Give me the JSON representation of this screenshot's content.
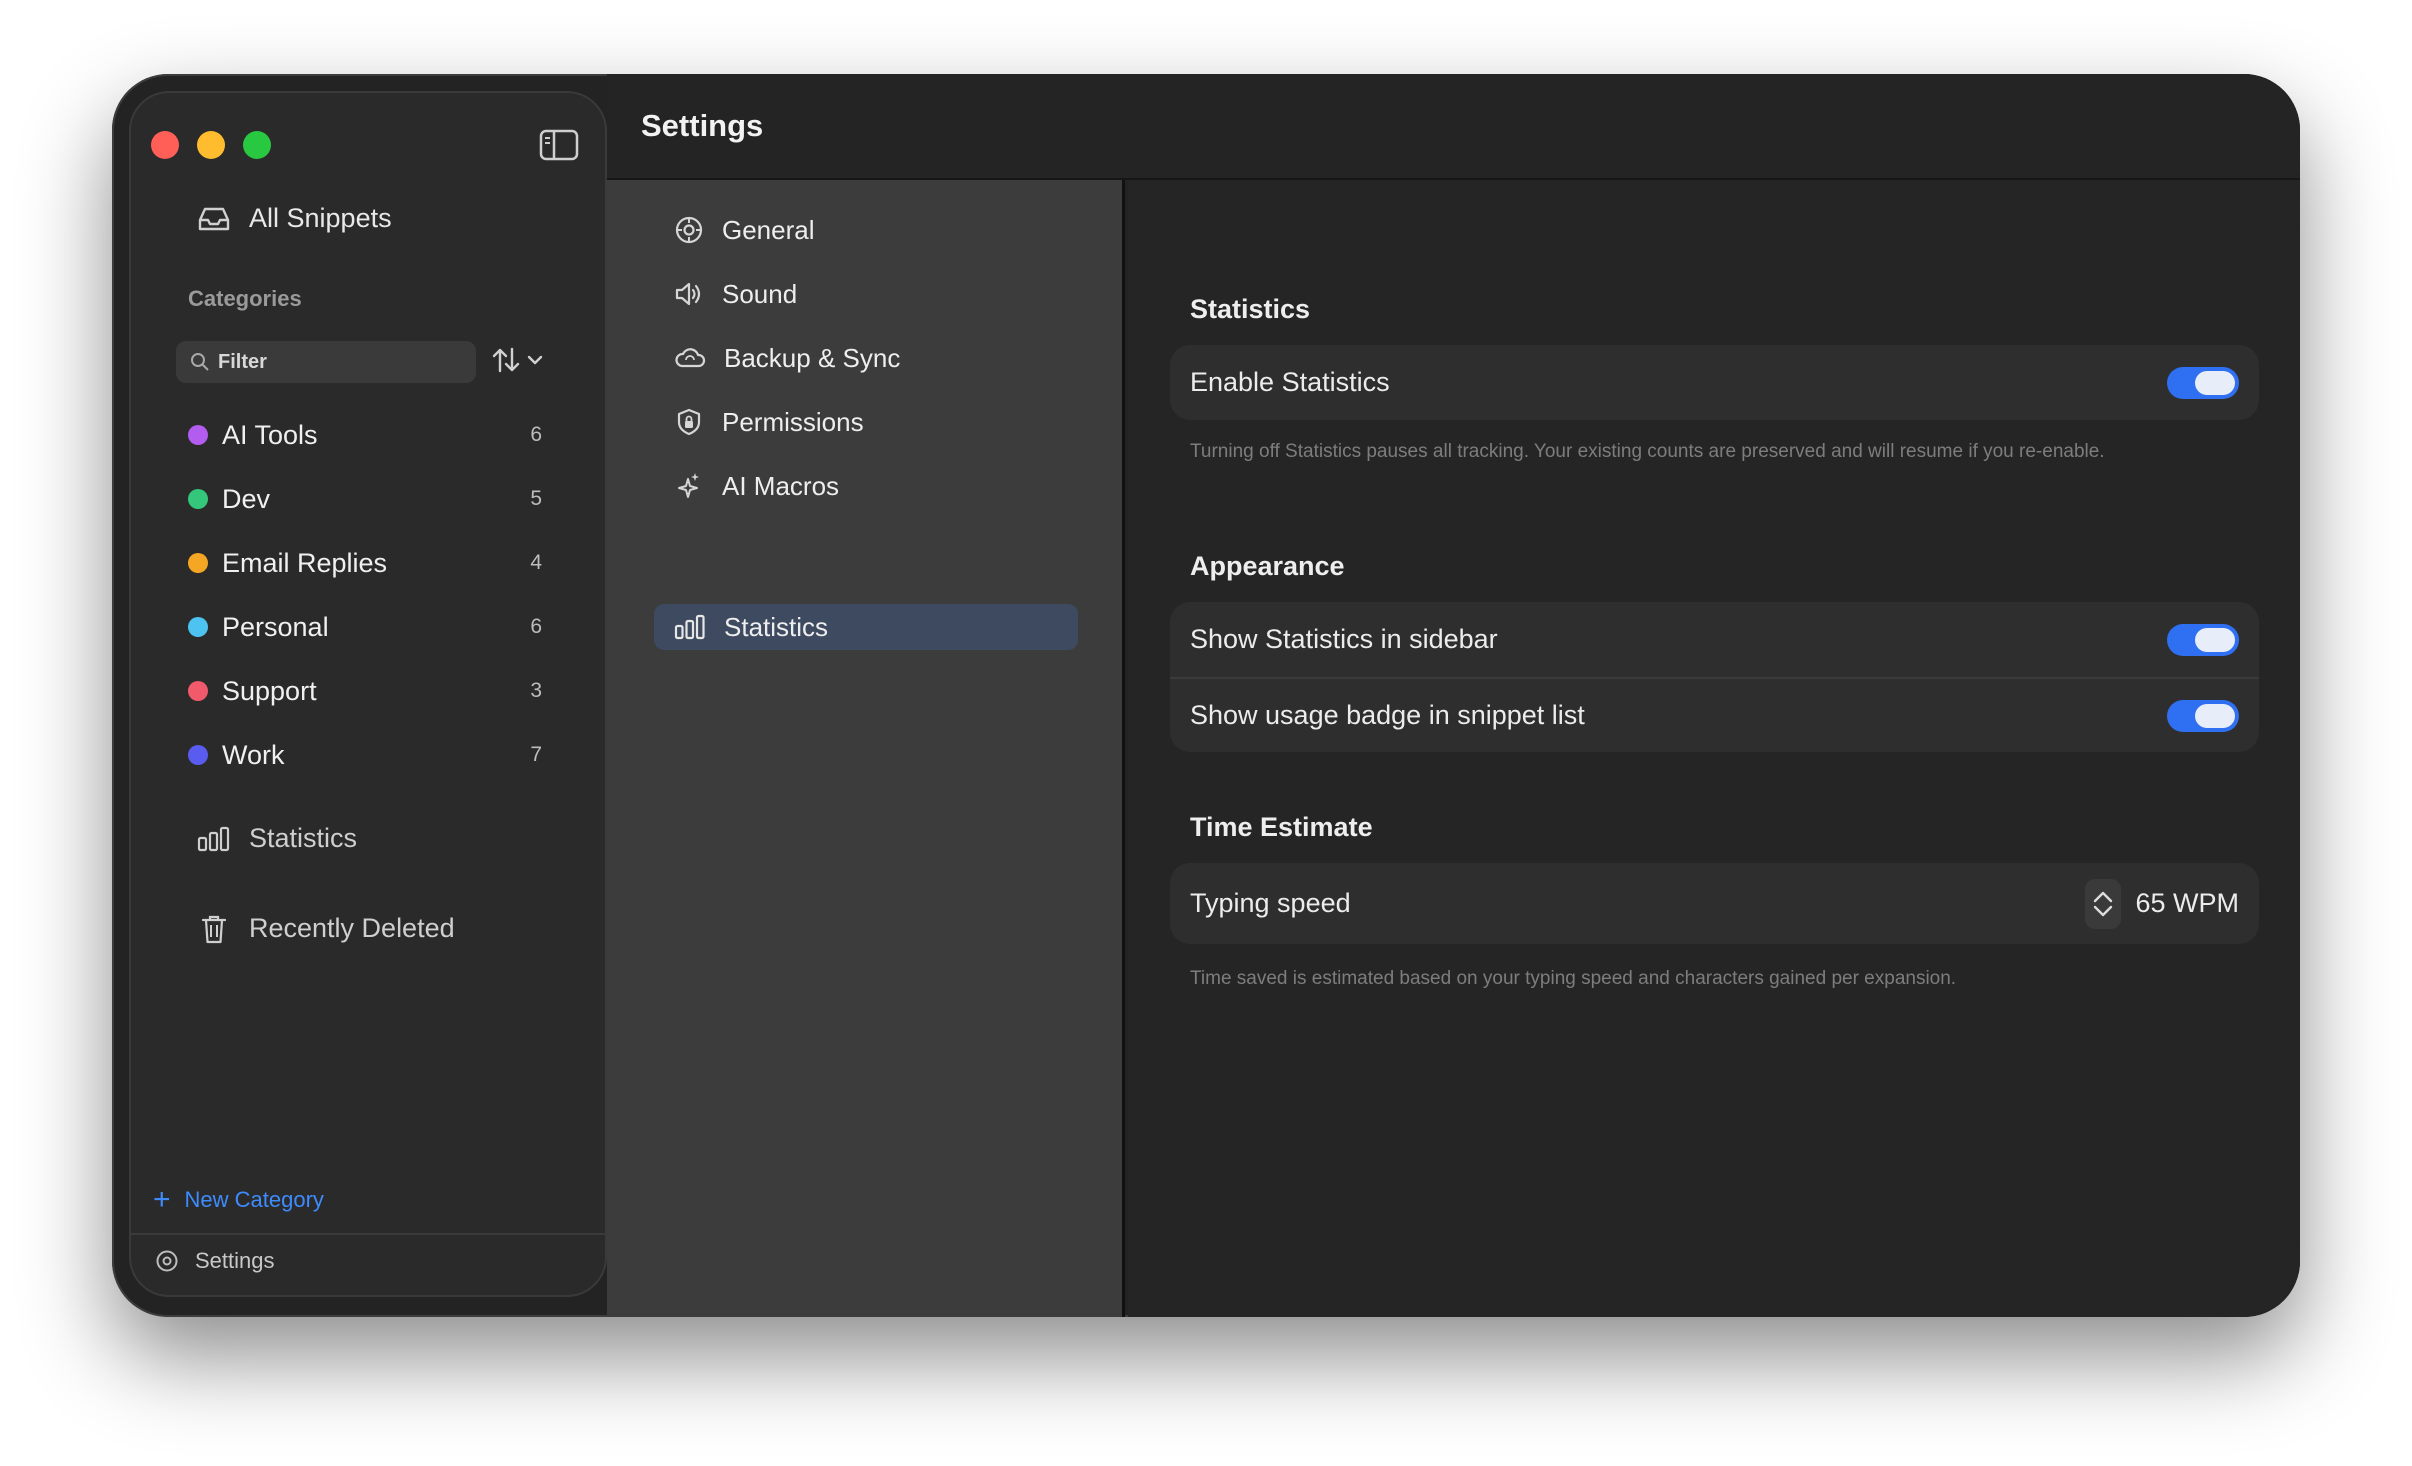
{
  "header": {
    "title": "Settings"
  },
  "sidebar": {
    "all_snippets": "All Snippets",
    "categories_heading": "Categories",
    "filter_placeholder": "Filter",
    "categories": [
      {
        "name": "AI Tools",
        "count": "6",
        "color": "#b35cf0"
      },
      {
        "name": "Dev",
        "count": "5",
        "color": "#34c77b"
      },
      {
        "name": "Email Replies",
        "count": "4",
        "color": "#f5a623"
      },
      {
        "name": "Personal",
        "count": "6",
        "color": "#4cc3f0"
      },
      {
        "name": "Support",
        "count": "3",
        "color": "#f05a6a"
      },
      {
        "name": "Work",
        "count": "7",
        "color": "#5a5cf0"
      }
    ],
    "statistics": "Statistics",
    "recently_deleted": "Recently Deleted",
    "new_category": "New Category",
    "settings": "Settings"
  },
  "nav": {
    "items": [
      {
        "label": "General",
        "icon": "gear-icon"
      },
      {
        "label": "Sound",
        "icon": "speaker-icon"
      },
      {
        "label": "Backup & Sync",
        "icon": "cloud-icon"
      },
      {
        "label": "Permissions",
        "icon": "lock-shield-icon"
      },
      {
        "label": "AI Macros",
        "icon": "sparkle-icon"
      },
      {
        "label": "Statistics",
        "icon": "bar-chart-icon"
      }
    ],
    "active": "Statistics"
  },
  "content": {
    "statistics": {
      "title": "Statistics",
      "enable_label": "Enable Statistics",
      "enable_on": true,
      "note": "Turning off Statistics pauses all tracking. Your existing counts are preserved and will resume if you re-enable."
    },
    "appearance": {
      "title": "Appearance",
      "sidebar_label": "Show Statistics in sidebar",
      "sidebar_on": true,
      "badge_label": "Show usage badge in snippet list",
      "badge_on": true
    },
    "time_estimate": {
      "title": "Time Estimate",
      "typing_label": "Typing speed",
      "typing_value": "65 WPM",
      "note": "Time saved is estimated based on your typing speed and characters gained per expansion."
    }
  },
  "colors": {
    "accent": "#2f6ff1",
    "link": "#3d8bfd"
  }
}
